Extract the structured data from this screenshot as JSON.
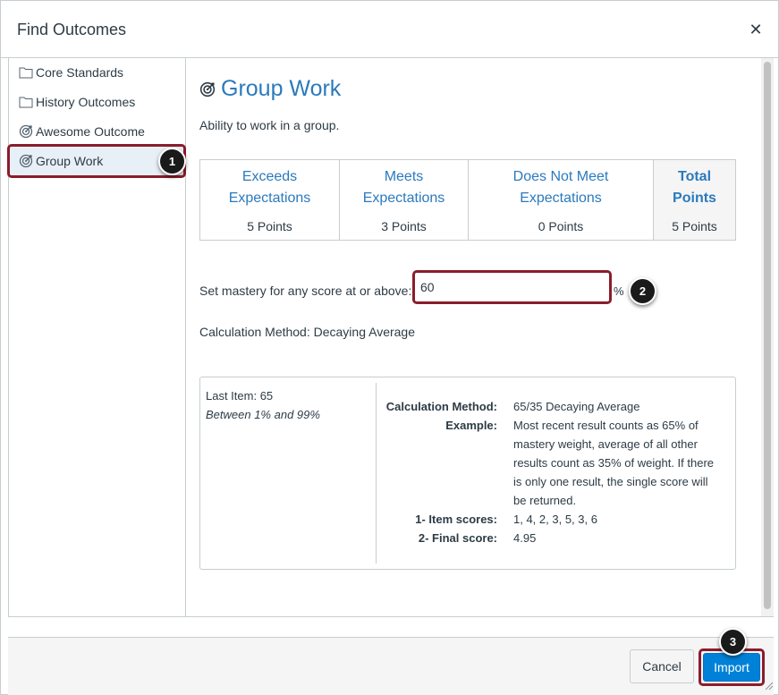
{
  "dialog": {
    "title": "Find Outcomes"
  },
  "sidebar": {
    "items": [
      {
        "label": "Core Standards",
        "icon": "folder-icon"
      },
      {
        "label": "History Outcomes",
        "icon": "folder-icon"
      },
      {
        "label": "Awesome Outcome",
        "icon": "outcome-target-icon"
      },
      {
        "label": "Group Work",
        "icon": "outcome-target-icon",
        "selected": true
      }
    ]
  },
  "outcome": {
    "title": "Group Work",
    "description": "Ability to work in a group.",
    "rubric": [
      {
        "label": "Exceeds Expectations",
        "points": "5 Points"
      },
      {
        "label": "Meets Expectations",
        "points": "3 Points"
      },
      {
        "label": "Does Not Meet Expectations",
        "points": "0 Points"
      },
      {
        "label": "Total Points",
        "points": "5 Points"
      }
    ],
    "mastery": {
      "label": "Set mastery for any score at or above:",
      "value": "60",
      "unit": "%"
    },
    "calculation_method_label": "Calculation Method: Decaying Average",
    "calc_box": {
      "last_item": "Last Item: 65",
      "range": "Between 1% and 99%",
      "rows": [
        {
          "key": "Calculation Method:",
          "value": "65/35 Decaying Average"
        },
        {
          "key": "Example:",
          "value": "Most recent result counts as 65% of mastery weight, average of all other results count as 35% of weight. If there is only one result, the single score will be returned."
        },
        {
          "key": "1- Item scores:",
          "value": "1, 4, 2, 3, 5, 3, 6"
        },
        {
          "key": "2- Final score:",
          "value": "4.95"
        }
      ]
    }
  },
  "footer": {
    "cancel_label": "Cancel",
    "import_label": "Import"
  },
  "callouts": {
    "one": "1",
    "two": "2",
    "three": "3"
  },
  "colors": {
    "accent": "#2b7abc",
    "primary_button": "#0081d8",
    "highlight": "#8b1c2b"
  }
}
